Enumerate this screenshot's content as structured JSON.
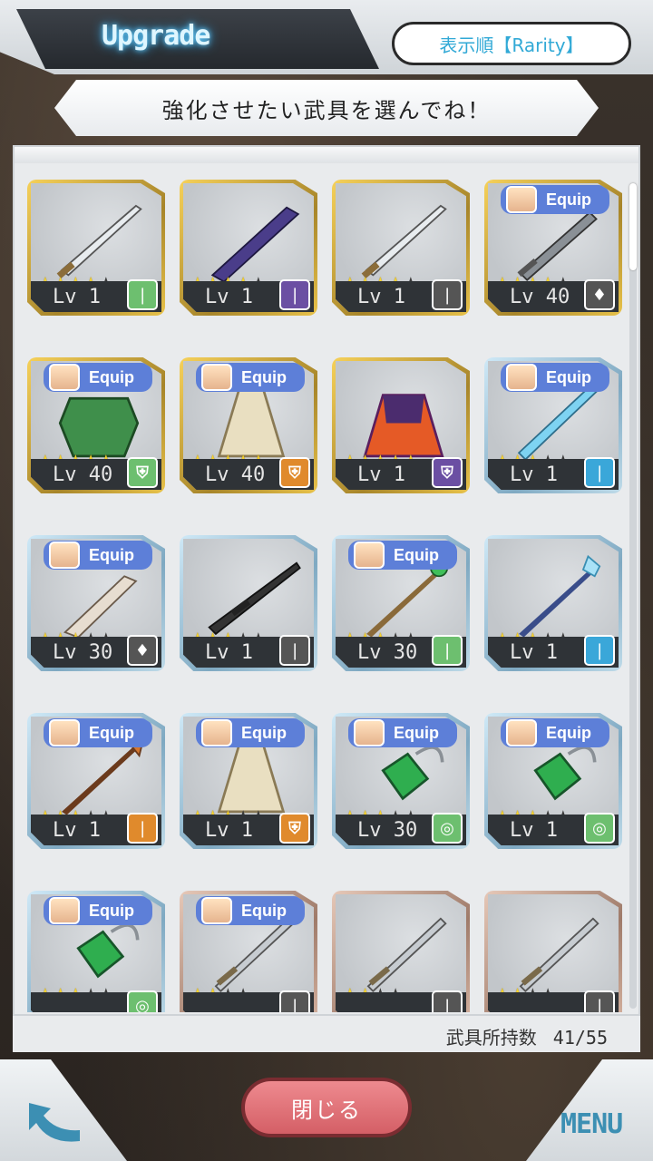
{
  "header": {
    "title": "Upgrade",
    "sort_label": "表示順【Rarity】"
  },
  "banner": {
    "text": "強化させたい武具を選んでね！"
  },
  "equip_label": "Equip",
  "items": [
    {
      "rarity": "r5",
      "stars": 4,
      "max": 5,
      "lv": "Lv 1",
      "equip": false,
      "type": "sword",
      "type_color": "#6dbf6f",
      "weapon": "katana-icon"
    },
    {
      "rarity": "r5",
      "stars": 4,
      "max": 5,
      "lv": "Lv 1",
      "equip": false,
      "type": "sword",
      "type_color": "#6b4fa3",
      "weapon": "greatsword-icon"
    },
    {
      "rarity": "r5",
      "stars": 4,
      "max": 5,
      "lv": "Lv 1",
      "equip": false,
      "type": "sword",
      "type_color": "#555555",
      "weapon": "katana-icon"
    },
    {
      "rarity": "r5",
      "stars": 4,
      "max": 5,
      "lv": "Lv 40",
      "equip": true,
      "type": "dagger",
      "type_color": "#555555",
      "weapon": "serrated-sword-icon"
    },
    {
      "rarity": "r5",
      "stars": 5,
      "max": 5,
      "lv": "Lv 40",
      "equip": true,
      "type": "armor",
      "type_color": "#6dbf6f",
      "weapon": "green-armor-icon"
    },
    {
      "rarity": "r5",
      "stars": 5,
      "max": 5,
      "lv": "Lv 40",
      "equip": true,
      "type": "armor",
      "type_color": "#e08a2c",
      "weapon": "white-robe-icon"
    },
    {
      "rarity": "r5",
      "stars": 5,
      "max": 5,
      "lv": "Lv 1",
      "equip": false,
      "type": "armor",
      "type_color": "#6b4fa3",
      "weapon": "red-dress-icon"
    },
    {
      "rarity": "r4",
      "stars": 3,
      "max": 5,
      "lv": "Lv 1",
      "equip": true,
      "type": "sword",
      "type_color": "#3aa7d9",
      "weapon": "ice-sword-icon"
    },
    {
      "rarity": "r4",
      "stars": 3,
      "max": 5,
      "lv": "Lv 30",
      "equip": true,
      "type": "dagger",
      "type_color": "#555555",
      "weapon": "bone-blade-icon"
    },
    {
      "rarity": "r4",
      "stars": 3,
      "max": 5,
      "lv": "Lv 1",
      "equip": false,
      "type": "gun",
      "type_color": "#555555",
      "weapon": "sniper-rifle-icon"
    },
    {
      "rarity": "r4",
      "stars": 3,
      "max": 5,
      "lv": "Lv 30",
      "equip": true,
      "type": "staff",
      "type_color": "#6dbf6f",
      "weapon": "orb-staff-icon"
    },
    {
      "rarity": "r4",
      "stars": 3,
      "max": 5,
      "lv": "Lv 1",
      "equip": false,
      "type": "staff",
      "type_color": "#3aa7d9",
      "weapon": "crystal-staff-icon"
    },
    {
      "rarity": "r4",
      "stars": 3,
      "max": 5,
      "lv": "Lv 1",
      "equip": true,
      "type": "spear",
      "type_color": "#e08a2c",
      "weapon": "flame-spear-icon"
    },
    {
      "rarity": "r4",
      "stars": 3,
      "max": 5,
      "lv": "Lv 1",
      "equip": true,
      "type": "armor",
      "type_color": "#e08a2c",
      "weapon": "white-robe-icon"
    },
    {
      "rarity": "r4",
      "stars": 3,
      "max": 5,
      "lv": "Lv 30",
      "equip": true,
      "type": "accessory",
      "type_color": "#6dbf6f",
      "weapon": "emerald-earring-icon"
    },
    {
      "rarity": "r4",
      "stars": 3,
      "max": 5,
      "lv": "Lv 1",
      "equip": true,
      "type": "accessory",
      "type_color": "#6dbf6f",
      "weapon": "emerald-earring-icon"
    },
    {
      "rarity": "r4",
      "stars": 3,
      "max": 5,
      "lv": "",
      "equip": true,
      "type": "accessory",
      "type_color": "#6dbf6f",
      "weapon": "emerald-earring-icon"
    },
    {
      "rarity": "r3",
      "stars": 2,
      "max": 4,
      "lv": "",
      "equip": true,
      "type": "sword",
      "type_color": "#555555",
      "weapon": "long-sword-icon"
    },
    {
      "rarity": "r3",
      "stars": 2,
      "max": 4,
      "lv": "",
      "equip": false,
      "type": "sword",
      "type_color": "#555555",
      "weapon": "long-sword-icon"
    },
    {
      "rarity": "r3",
      "stars": 2,
      "max": 4,
      "lv": "",
      "equip": false,
      "type": "sword",
      "type_color": "#555555",
      "weapon": "long-sword-icon"
    }
  ],
  "footer": {
    "count_label": "武具所持数",
    "count_value": "41/55",
    "close_label": "閉じる",
    "menu_label": "MENU"
  }
}
